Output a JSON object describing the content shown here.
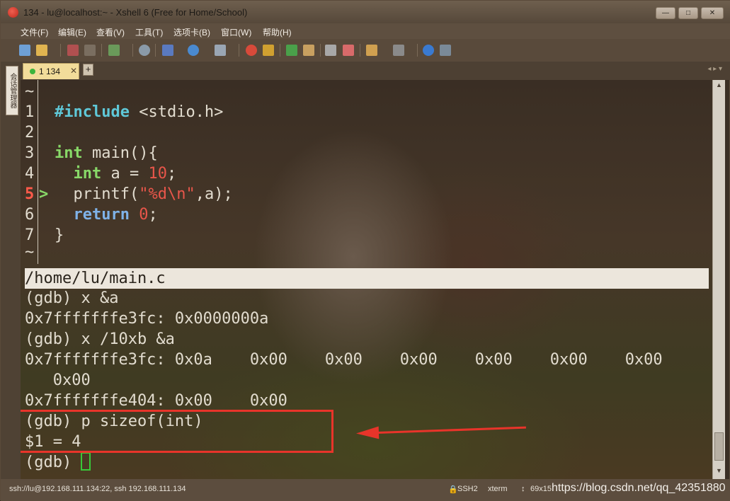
{
  "window": {
    "title": "134 - lu@localhost:~ - Xshell 6 (Free for Home/School)",
    "controls": {
      "minimize": "—",
      "maximize": "□",
      "close": "✕"
    }
  },
  "menu": [
    "文件(F)",
    "编辑(E)",
    "查看(V)",
    "工具(T)",
    "选项卡(B)",
    "窗口(W)",
    "帮助(H)"
  ],
  "side_panel": {
    "label": "会话管理器"
  },
  "tabs": {
    "active": {
      "label": "1 134",
      "close": "✕"
    },
    "add": "+",
    "nav": "◂ ▸ ▾"
  },
  "terminal": {
    "tilde_top": "~",
    "code": [
      {
        "num": "1",
        "parts": [
          {
            "t": "#include",
            "c": "kw-pre"
          },
          {
            "t": " <stdio.h>",
            "c": ""
          }
        ]
      },
      {
        "num": "2",
        "parts": []
      },
      {
        "num": "3",
        "parts": [
          {
            "t": "int",
            "c": "kw"
          },
          {
            "t": " main(){",
            "c": ""
          }
        ]
      },
      {
        "num": "4",
        "parts": [
          {
            "t": "  ",
            "c": ""
          },
          {
            "t": "int",
            "c": "kw"
          },
          {
            "t": " a = ",
            "c": ""
          },
          {
            "t": "10",
            "c": "num"
          },
          {
            "t": ";",
            "c": ""
          }
        ]
      },
      {
        "num": "5",
        "marker": ">",
        "parts": [
          {
            "t": "  printf(",
            "c": ""
          },
          {
            "t": "\"%d\\n\"",
            "c": "str"
          },
          {
            "t": ",a);",
            "c": ""
          }
        ]
      },
      {
        "num": "6",
        "parts": [
          {
            "t": "  ",
            "c": ""
          },
          {
            "t": "return",
            "c": "kw-ret"
          },
          {
            "t": " ",
            "c": ""
          },
          {
            "t": "0",
            "c": "num"
          },
          {
            "t": ";",
            "c": ""
          }
        ]
      },
      {
        "num": "7",
        "parts": [
          {
            "t": "}",
            "c": ""
          }
        ]
      }
    ],
    "tilde_bottom": "~",
    "file_status": "/home/lu/main.c",
    "gdb_lines": [
      "(gdb) x &a",
      "0x7fffffffe3fc: 0x0000000a",
      "(gdb) x /10xb &a",
      "0x7fffffffe3fc: 0x0a    0x00    0x00    0x00    0x00    0x00    0x00",
      "   0x00",
      "0x7fffffffe404: 0x00    0x00",
      "(gdb) p sizeof(int)",
      "$1 = 4"
    ],
    "prompt": "(gdb) "
  },
  "statusbar": {
    "connection": "ssh://lu@192.168.111.134:22, ssh 192.168.111.134",
    "protocol": "SSH2",
    "term": "xterm",
    "size": "69x15",
    "watermark": "https://blog.csdn.net/qq_42351880"
  },
  "colors": {
    "highlight": "#e8342a",
    "cursor": "#38c838",
    "tab_active": "#f2dc9a"
  }
}
